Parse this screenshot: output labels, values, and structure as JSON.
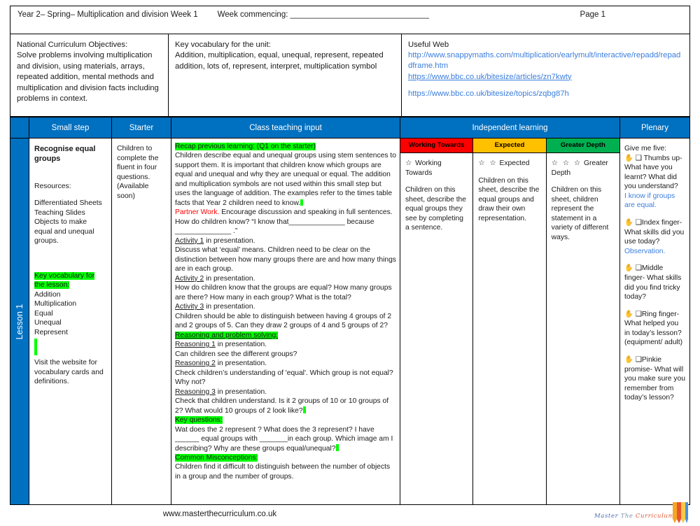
{
  "header": {
    "title": "Year 2– Spring– Multiplication and division Week  1",
    "week_commencing_label": "Week commencing: _______________________________",
    "page_label": "Page 1"
  },
  "info": {
    "nc_title": "National Curriculum Objectives:",
    "nc_text": "Solve problems involving multiplication and division, using materials, arrays, repeated addition, mental methods and multiplication and division facts including problems in context.",
    "kv_title": "Key vocabulary for the unit:",
    "kv_text": "Addition, multiplication, equal, unequal, represent, repeated addition, lots of, represent, interpret, multiplication symbol",
    "web_title": "Useful Web",
    "web_links": [
      "http://www.snappymaths.com/multiplication/earlymult/interactive/repadd/repaddframe.htm",
      "https://www.bbc.co.uk/bitesize/articles/zn7kwty",
      "https://www.bbc.co.uk/bitesize/topics/zqbg87h"
    ]
  },
  "table": {
    "headers": {
      "lesson": "",
      "small_step": "Small step",
      "starter": "Starter",
      "class_teaching": "Class teaching input",
      "independent": "Independent learning",
      "plenary": "Plenary"
    },
    "lesson_tab": "Lesson 1",
    "small_step": {
      "title": "Recognise equal groups",
      "resources_label": "Resources:",
      "resources": [
        "Differentiated Sheets",
        "Teaching Slides",
        "Objects to make equal and unequal groups."
      ],
      "key_vocab_title": "Key vocabulary for the lesson:",
      "key_vocab": [
        "Addition",
        "Multiplication",
        "Equal",
        "Unequal",
        "Represent"
      ],
      "footer_note": "Visit the website for vocabulary cards and definitions."
    },
    "starter": {
      "text": "Children to complete the fluent in four questions. (Available soon)"
    },
    "class_teaching": {
      "recap_heading": "Recap previous learning: (Q1 on the starter)",
      "recap_body": "Children describe equal and unequal groups using stem sentences to support them. It is important that children know which groups are equal and unequal and why they are  unequal or equal. The addition and multiplication symbols are not used within this small step but uses the language of addition. The examples refer to the times table facts that Year 2 children need to know.",
      "partner_work_label": "Partner Work.",
      "partner_work_body": "Encourage discussion and speaking in full sentences. How do children know?  “I know that______________ because ______________ .”",
      "activity1_label": "Activity 1",
      "activity1_suffix": " in presentation.",
      "activity1_body": "Discuss what ‘equal’ means. Children need to be clear on the distinction between how many groups there are and how many things are in each group.",
      "activity2_label": "Activity 2",
      "activity2_suffix": " in presentation.",
      "activity2_body": "How do children know that the groups are equal? How many groups are there? How many in each group? What is the total?",
      "activity3_label": "Activity 3",
      "activity3_suffix": " in presentation.",
      "activity3_body": "Children should be able to distinguish between having 4 groups of 2 and 2 groups of 5. Can they draw 2 groups of 4 and 5 groups of 2?",
      "reasoning_heading": "Reasoning and problem solving:",
      "reasoning1_label": "Reasoning 1",
      "reasoning1_suffix": " in presentation.",
      "reasoning1_body": "Can children see the different groups?",
      "reasoning2_label": "Reasoning 2",
      "reasoning2_suffix": " in presentation.",
      "reasoning2_body": "Check children’s understanding of 'equal'. Which group is not equal? Why not?",
      "reasoning3_label": "Reasoning 3",
      "reasoning3_suffix": " in presentation.",
      "reasoning3_body": "Check that children understand. Is it 2 groups of 10 or 10 groups of 2? What would 10 groups of 2 look like?",
      "key_questions_heading": "Key questions:",
      "key_questions_body": "Wat does the 2 represent ? What does the 3 represent? I have ______ equal groups with _______in each group. Which image am I describing? Why are these groups equal/unequal?",
      "misconceptions_heading": "Common Misconceptions:",
      "misconceptions_body": "Children find it difficult to distinguish between the number of objects in a group and the number of groups."
    },
    "independent": {
      "columns": [
        {
          "header": "Working Towards",
          "header_color": "#ff0000",
          "stars": "☆",
          "star_label": "Working Towards",
          "body": "Children on this sheet, describe the equal groups they see by completing a sentence."
        },
        {
          "header": "Expected",
          "header_color": "#ffc000",
          "stars": "☆ ☆",
          "star_label": "Expected",
          "body": "Children on this sheet, describe the equal groups and draw their own representation."
        },
        {
          "header": "Greater Depth",
          "header_color": "#00b050",
          "stars": "☆ ☆ ☆",
          "star_label": "Greater Depth",
          "body": "Children on this sheet, children represent the statement in a variety of different ways."
        }
      ]
    },
    "plenary": {
      "intro": "Give me five:",
      "items": [
        {
          "icon": "✋ ❑",
          "text": "Thumbs up- What have you learnt? What did you understand?",
          "answer": "I know if groups are equal."
        },
        {
          "icon": "✋ ❑",
          "text": "Index finger- What skills did you use today?",
          "answer": "Observation."
        },
        {
          "icon": "✋ ❑",
          "text": "Middle finger- What skills did you find tricky today?",
          "answer": ""
        },
        {
          "icon": "✋ ❑",
          "text": "Ring finger- What helped you in today’s lesson? (equipment/ adult)",
          "answer": ""
        },
        {
          "icon": "✋ ❑",
          "text": "Pinkie promise- What will you make sure you remember from today’s lesson?",
          "answer": ""
        }
      ]
    }
  },
  "footer": {
    "url": "www.masterthecurriculum.co.uk",
    "logo_word1": "Master",
    "logo_word2": "The",
    "logo_word3": "Curriculum"
  },
  "colors": {
    "header_blue": "#0070c0",
    "working_towards": "#ff0000",
    "expected": "#ffc000",
    "greater_depth": "#00b050",
    "highlight_green": "#00ff00",
    "link_blue": "#3b7ddd",
    "partner_red": "#ff0000"
  }
}
